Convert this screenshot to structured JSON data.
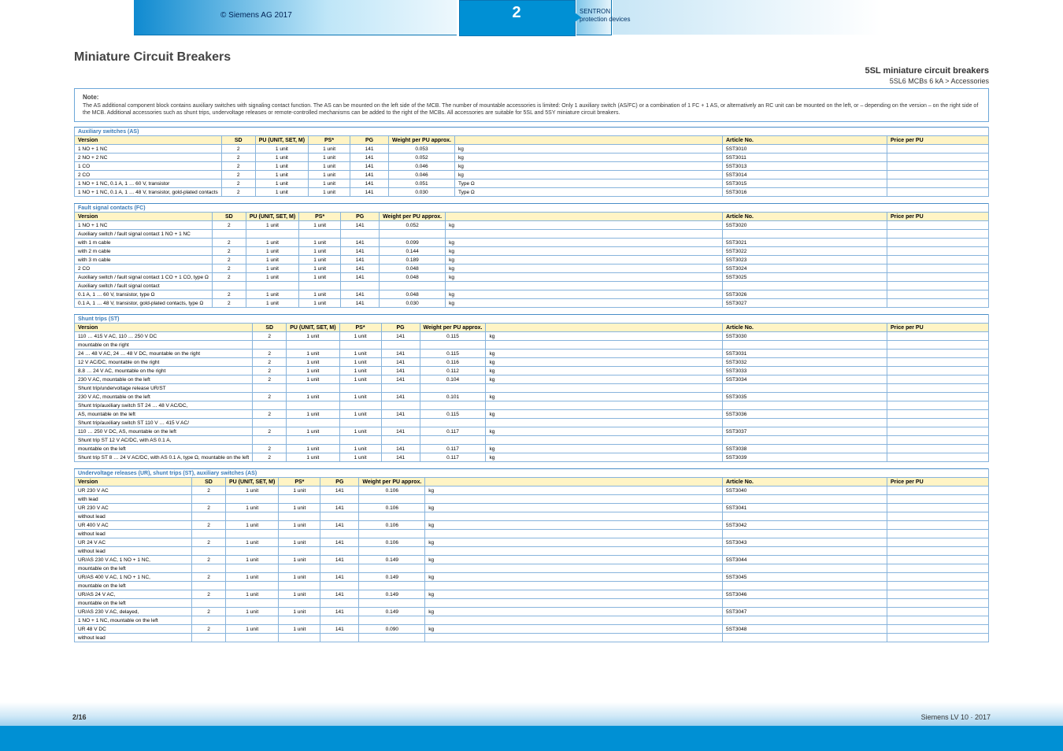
{
  "top": {
    "leftCaption": "© Siemens AG 2017",
    "chapter_l1": "2",
    "chapter_l2": "",
    "tab_l1": "SENTRON",
    "tab_l2": "protection devices"
  },
  "title": {
    "main": "Miniature Circuit Breakers",
    "section": "5SL miniature circuit breakers",
    "sub": "5SL6 MCBs 6 kA > Accessories"
  },
  "notebox": {
    "hd": "Note:",
    "lines": [
      "The AS additional component block contains auxiliary switches with signaling contact function. The AS can be mounted on the left side of the MCB. The number of mountable accessories is limited: Only 1 auxiliary switch (AS/FC) or a combination of 1 FC + 1 AS, or alternatively an RC unit can be mounted on the left, or – depending on the version – on the right side of the MCB. Additional accessories such as shunt trips, undervoltage releases or remote-controlled mechanisms can be added to the right of the MCBs. All accessories are suitable for 5SL and 5SY miniature circuit breakers."
    ]
  },
  "headers": [
    "Version",
    "SD",
    "PU (UNIT, SET, M)",
    "PS*",
    "PG",
    "Weight per PU approx.",
    "",
    "Article No.",
    "Price per PU"
  ],
  "headers_stock": [
    "Article No.",
    "SD",
    "PU (UNIT, SET, M)",
    "PS*",
    "PG",
    "Weight per PU approx.",
    "",
    "Article No.",
    "Price per PU"
  ],
  "groups": [
    {
      "cat": "Auxiliary switches (AS)",
      "rows": [
        {
          "v": "1 NO + 1 NC",
          "sd": "2",
          "pu": "1 unit",
          "ps": "1 unit",
          "pg": "141",
          "w": "0.053",
          "unit": "kg",
          "art": "5ST3010"
        },
        {
          "v": "2 NO + 2 NC",
          "sd": "2",
          "pu": "1 unit",
          "ps": "1 unit",
          "pg": "141",
          "w": "0.052",
          "unit": "kg",
          "art": "5ST3011"
        },
        {
          "v": "1 CO",
          "sd": "2",
          "pu": "1 unit",
          "ps": "1 unit",
          "pg": "141",
          "w": "0.046",
          "unit": "kg",
          "art": "5ST3013"
        },
        {
          "v": "2 CO",
          "sd": "2",
          "pu": "1 unit",
          "ps": "1 unit",
          "pg": "141",
          "w": "0.046",
          "unit": "kg",
          "art": "5ST3014"
        },
        {
          "v": "1 NO + 1 NC, 0.1 A, 1 … 60 V, transistor",
          "sd": "2",
          "pu": "1 unit",
          "ps": "1 unit",
          "pg": "141",
          "w": "0.051",
          "unit": "kg",
          "art": "5ST3015",
          "note": "Type Ω"
        },
        {
          "v": "1 NO + 1 NC, 0.1 A, 1 … 48 V, transistor, gold-plated contacts",
          "sd": "2",
          "pu": "1 unit",
          "ps": "1 unit",
          "pg": "141",
          "w": "0.030",
          "unit": "kg",
          "art": "5ST3016",
          "note": "Type Ω"
        }
      ]
    },
    {
      "cat": "Fault signal contacts (FC)",
      "rows": [
        {
          "v": "1 NO + 1 NC",
          "sd": "2",
          "pu": "1 unit",
          "ps": "1 unit",
          "pg": "141",
          "w": "0.052",
          "unit": "kg",
          "art": "5ST3020"
        },
        {
          "v": "Auxiliary switch / fault signal contact 1 NO + 1 NC",
          "sd": "",
          "pu": "",
          "ps": "",
          "pg": "",
          "w": "",
          "unit": "",
          "art": ""
        },
        {
          "v": "with 1 m cable",
          "sd": "2",
          "pu": "1 unit",
          "ps": "1 unit",
          "pg": "141",
          "w": "0.099",
          "unit": "kg",
          "art": "5ST3021"
        },
        {
          "v": "with 2 m cable",
          "sd": "2",
          "pu": "1 unit",
          "ps": "1 unit",
          "pg": "141",
          "w": "0.144",
          "unit": "kg",
          "art": "5ST3022"
        },
        {
          "v": "with 3 m cable",
          "sd": "2",
          "pu": "1 unit",
          "ps": "1 unit",
          "pg": "141",
          "w": "0.189",
          "unit": "kg",
          "art": "5ST3023"
        },
        {
          "v": "2 CO",
          "sd": "2",
          "pu": "1 unit",
          "ps": "1 unit",
          "pg": "141",
          "w": "0.048",
          "unit": "kg",
          "art": "5ST3024"
        },
        {
          "v": "Auxiliary switch / fault signal contact 1 CO + 1 CO, type Ω",
          "sd": "2",
          "pu": "1 unit",
          "ps": "1 unit",
          "pg": "141",
          "w": "0.048",
          "unit": "kg",
          "art": "5ST3025"
        },
        {
          "v": "Auxiliary switch / fault signal contact",
          "sd": "",
          "pu": "",
          "ps": "",
          "pg": "",
          "w": "",
          "unit": "",
          "art": ""
        },
        {
          "v": "0.1 A, 1 … 60 V, transistor, type Ω",
          "sd": "2",
          "pu": "1 unit",
          "ps": "1 unit",
          "pg": "141",
          "w": "0.048",
          "unit": "kg",
          "art": "5ST3026"
        },
        {
          "v": "0.1 A, 1 … 48 V, transistor, gold-plated contacts, type Ω",
          "sd": "2",
          "pu": "1 unit",
          "ps": "1 unit",
          "pg": "141",
          "w": "0.030",
          "unit": "kg",
          "art": "5ST3027"
        }
      ]
    },
    {
      "cat": "Shunt trips (ST)",
      "rows": [
        {
          "v": "110 … 415 V AC, 110 … 250 V DC",
          "sd": "2",
          "pu": "1 unit",
          "ps": "1 unit",
          "pg": "141",
          "w": "0.115",
          "unit": "kg",
          "art": "5ST3030"
        },
        {
          "v": "mountable on the right",
          "sd": "",
          "pu": "",
          "ps": "",
          "pg": "",
          "w": "",
          "unit": "",
          "art": ""
        },
        {
          "v": "24 … 48 V AC, 24 … 48 V DC, mountable on the right",
          "sd": "2",
          "pu": "1 unit",
          "ps": "1 unit",
          "pg": "141",
          "w": "0.115",
          "unit": "kg",
          "art": "5ST3031"
        },
        {
          "v": "12 V AC/DC, mountable on the right",
          "sd": "2",
          "pu": "1 unit",
          "ps": "1 unit",
          "pg": "141",
          "w": "0.116",
          "unit": "kg",
          "art": "5ST3032"
        },
        {
          "v": "8.8 … 24 V AC, mountable on the right",
          "sd": "2",
          "pu": "1 unit",
          "ps": "1 unit",
          "pg": "141",
          "w": "0.112",
          "unit": "kg",
          "art": "5ST3033"
        },
        {
          "v": "230 V AC, mountable on the left",
          "sd": "2",
          "pu": "1 unit",
          "ps": "1 unit",
          "pg": "141",
          "w": "0.104",
          "unit": "kg",
          "art": "5ST3034"
        },
        {
          "v": "Shunt trip/undervoltage release UR/ST",
          "sd": "",
          "pu": "",
          "ps": "",
          "pg": "",
          "w": "",
          "unit": "",
          "art": ""
        },
        {
          "v": "230 V AC, mountable on the left",
          "sd": "2",
          "pu": "1 unit",
          "ps": "1 unit",
          "pg": "141",
          "w": "0.101",
          "unit": "kg",
          "art": "5ST3035"
        },
        {
          "v": "Shunt trip/auxiliary switch ST 24 … 48 V AC/DC,",
          "sd": "",
          "pu": "",
          "ps": "",
          "pg": "",
          "w": "",
          "unit": "",
          "art": ""
        },
        {
          "v": "AS, mountable on the left",
          "sd": "2",
          "pu": "1 unit",
          "ps": "1 unit",
          "pg": "141",
          "w": "0.115",
          "unit": "kg",
          "art": "5ST3036"
        },
        {
          "v": "Shunt trip/auxiliary switch ST 110 V … 415 V AC/",
          "sd": "",
          "pu": "",
          "ps": "",
          "pg": "",
          "w": "",
          "unit": "",
          "art": ""
        },
        {
          "v": "110 … 250 V DC, AS, mountable on the left",
          "sd": "2",
          "pu": "1 unit",
          "ps": "1 unit",
          "pg": "141",
          "w": "0.117",
          "unit": "kg",
          "art": "5ST3037"
        },
        {
          "v": "Shunt trip ST 12 V AC/DC, with AS 0.1 A,",
          "sd": "",
          "pu": "",
          "ps": "",
          "pg": "",
          "w": "",
          "unit": "",
          "art": ""
        },
        {
          "v": "mountable on the left",
          "sd": "2",
          "pu": "1 unit",
          "ps": "1 unit",
          "pg": "141",
          "w": "0.117",
          "unit": "kg",
          "art": "5ST3038"
        },
        {
          "v": "Shunt trip ST 8 … 24 V AC/DC, with AS 0.1 A, type Ω, mountable on the left",
          "sd": "2",
          "pu": "1 unit",
          "ps": "1 unit",
          "pg": "141",
          "w": "0.117",
          "unit": "kg",
          "art": "5ST3039"
        }
      ]
    },
    {
      "cat": "Undervoltage releases (UR), shunt trips (ST), auxiliary switches (AS)",
      "rows": [
        {
          "v": "UR 230 V AC",
          "sd": "2",
          "pu": "1 unit",
          "ps": "1 unit",
          "pg": "141",
          "w": "0.106",
          "unit": "kg",
          "art": "5ST3040"
        },
        {
          "v": "with lead",
          "sd": "",
          "pu": "",
          "ps": "",
          "pg": "",
          "w": "",
          "unit": "",
          "art": ""
        },
        {
          "v": "UR 230 V AC",
          "sd": "2",
          "pu": "1 unit",
          "ps": "1 unit",
          "pg": "141",
          "w": "0.106",
          "unit": "kg",
          "art": "5ST3041"
        },
        {
          "v": "without lead",
          "sd": "",
          "pu": "",
          "ps": "",
          "pg": "",
          "w": "",
          "unit": "",
          "art": ""
        },
        {
          "v": "UR 400 V AC",
          "sd": "2",
          "pu": "1 unit",
          "ps": "1 unit",
          "pg": "141",
          "w": "0.106",
          "unit": "kg",
          "art": "5ST3042"
        },
        {
          "v": "without lead",
          "sd": "",
          "pu": "",
          "ps": "",
          "pg": "",
          "w": "",
          "unit": "",
          "art": ""
        },
        {
          "v": "UR 24 V AC",
          "sd": "2",
          "pu": "1 unit",
          "ps": "1 unit",
          "pg": "141",
          "w": "0.106",
          "unit": "kg",
          "art": "5ST3043"
        },
        {
          "v": "without lead",
          "sd": "",
          "pu": "",
          "ps": "",
          "pg": "",
          "w": "",
          "unit": "",
          "art": ""
        },
        {
          "v": "UR/AS 230 V AC, 1 NO + 1 NC,",
          "sd": "2",
          "pu": "1 unit",
          "ps": "1 unit",
          "pg": "141",
          "w": "0.149",
          "unit": "kg",
          "art": "5ST3044"
        },
        {
          "v": "mountable on the left",
          "sd": "",
          "pu": "",
          "ps": "",
          "pg": "",
          "w": "",
          "unit": "",
          "art": ""
        },
        {
          "v": "UR/AS 400 V AC, 1 NO + 1 NC,",
          "sd": "2",
          "pu": "1 unit",
          "ps": "1 unit",
          "pg": "141",
          "w": "0.149",
          "unit": "kg",
          "art": "5ST3045"
        },
        {
          "v": "mountable on the left",
          "sd": "",
          "pu": "",
          "ps": "",
          "pg": "",
          "w": "",
          "unit": "",
          "art": ""
        },
        {
          "v": "UR/AS 24 V AC,",
          "sd": "2",
          "pu": "1 unit",
          "ps": "1 unit",
          "pg": "141",
          "w": "0.149",
          "unit": "kg",
          "art": "5ST3046"
        },
        {
          "v": "mountable on the left",
          "sd": "",
          "pu": "",
          "ps": "",
          "pg": "",
          "w": "",
          "unit": "",
          "art": ""
        },
        {
          "v": "UR/AS 230 V AC, delayed,",
          "sd": "2",
          "pu": "1 unit",
          "ps": "1 unit",
          "pg": "141",
          "w": "0.149",
          "unit": "kg",
          "art": "5ST3047"
        },
        {
          "v": "1 NO + 1 NC, mountable on the left",
          "sd": "",
          "pu": "",
          "ps": "",
          "pg": "",
          "w": "",
          "unit": "",
          "art": ""
        },
        {
          "v": "UR 48 V DC",
          "sd": "2",
          "pu": "1 unit",
          "ps": "1 unit",
          "pg": "141",
          "w": "0.090",
          "unit": "kg",
          "art": "5ST3048"
        },
        {
          "v": "without lead",
          "sd": "",
          "pu": "",
          "ps": "",
          "pg": "",
          "w": "",
          "unit": "",
          "art": ""
        }
      ]
    }
  ],
  "footer": {
    "page": "2/16",
    "ref": "Siemens LV 10 · 2017"
  }
}
